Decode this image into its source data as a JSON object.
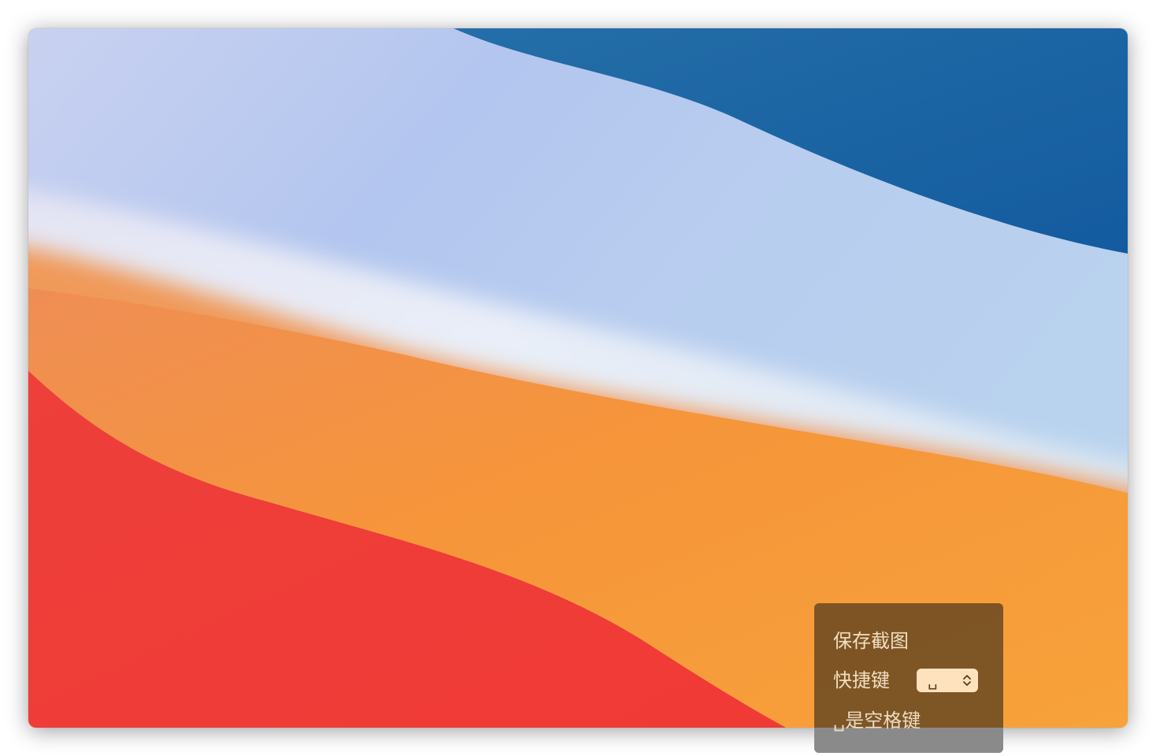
{
  "wallpaper": {
    "colors": {
      "sky_light": "#c8d2f1",
      "sky_mid": "#a8bfee",
      "sky_pale": "#e9eff8",
      "deep_blue": "#1a5fa3",
      "orange": "#f6943a",
      "red": "#ee3a36"
    }
  },
  "panel": {
    "save_label": "保存截图",
    "shortcut_label": "快捷键",
    "shortcut_value": "␣",
    "hint": "␣是空格键",
    "colors": {
      "background": "#7a5730",
      "text": "#f1dfc2",
      "select_bg": "#fde2bd"
    },
    "select_icon": "chevron-up-down-icon"
  }
}
